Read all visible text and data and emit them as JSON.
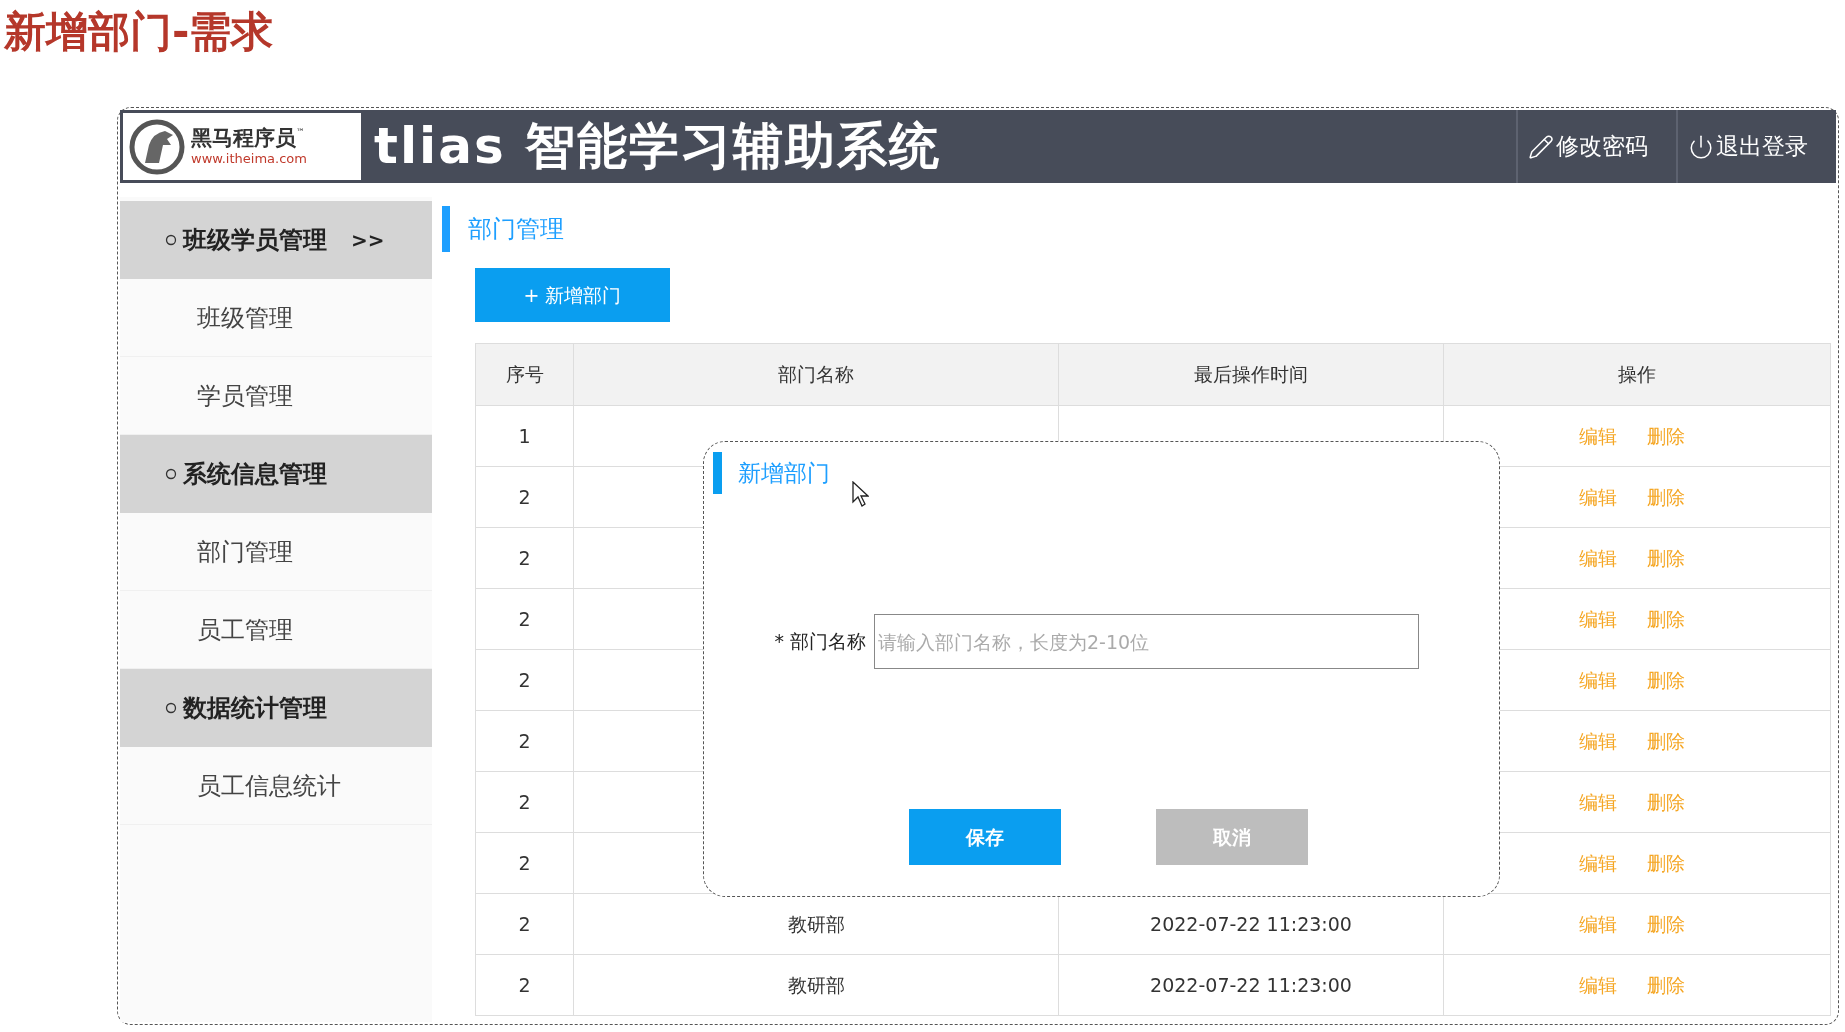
{
  "slide_title": "新增部门-需求",
  "header": {
    "logo": {
      "name": "黑马程序员",
      "trademark": "™",
      "url": "www.itheima.com"
    },
    "title": "tlias 智能学习辅助系统",
    "actions": [
      {
        "kind": "edit",
        "label": "修改密码"
      },
      {
        "kind": "logout",
        "label": "退出登录"
      }
    ]
  },
  "sidebar": [
    {
      "label": "班级学员管理",
      "arrow": ">>",
      "children": [
        {
          "label": "班级管理"
        },
        {
          "label": "学员管理"
        }
      ]
    },
    {
      "label": "系统信息管理",
      "children": [
        {
          "label": "部门管理"
        },
        {
          "label": "员工管理"
        }
      ]
    },
    {
      "label": "数据统计管理",
      "children": [
        {
          "label": "员工信息统计"
        }
      ]
    }
  ],
  "page_title": "部门管理",
  "add_button": "+ 新增部门",
  "table": {
    "columns": [
      "序号",
      "部门名称",
      "最后操作时间",
      "操作"
    ],
    "rows": [
      {
        "index": "1",
        "actions": [
          "编辑",
          "删除"
        ]
      },
      {
        "index": "2",
        "actions": [
          "编辑",
          "删除"
        ]
      },
      {
        "index": "2",
        "actions": [
          "编辑",
          "删除"
        ]
      },
      {
        "index": "2",
        "actions": [
          "编辑",
          "删除"
        ]
      },
      {
        "index": "2",
        "actions": [
          "编辑",
          "删除"
        ]
      },
      {
        "index": "2",
        "actions": [
          "编辑",
          "删除"
        ]
      },
      {
        "index": "2",
        "actions": [
          "编辑",
          "删除"
        ]
      },
      {
        "index": "2",
        "actions": [
          "编辑",
          "删除"
        ]
      },
      {
        "index": "2",
        "name": "教研部",
        "time": "2022-07-22 11:23:00",
        "actions": [
          "编辑",
          "删除"
        ]
      },
      {
        "index": "2",
        "name": "教研部",
        "time": "2022-07-22 11:23:00",
        "actions": [
          "编辑",
          "删除"
        ]
      }
    ]
  },
  "dialog": {
    "title": "新增部门",
    "field": {
      "label": "* 部门名称",
      "placeholder": "请输入部门名称，长度为2-10位"
    },
    "buttons": [
      {
        "label": "保存",
        "kind": "primary"
      },
      {
        "label": "取消",
        "kind": "secondary"
      }
    ]
  }
}
